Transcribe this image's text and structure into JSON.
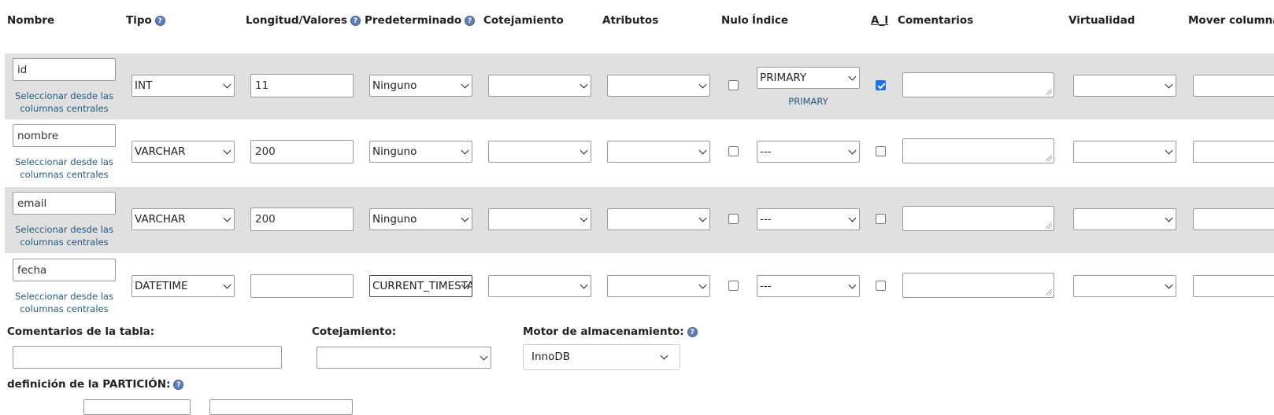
{
  "headers": {
    "nombre": "Nombre",
    "tipo": "Tipo",
    "longitud": "Longitud/Valores",
    "predeterminado": "Predeterminado",
    "cotejamiento": "Cotejamiento",
    "atributos": "Atributos",
    "nulo": "Nulo",
    "indice": "Índice",
    "ai": "A_I",
    "comentarios": "Comentarios",
    "virtualidad": "Virtualidad",
    "mover": "Mover columna"
  },
  "rows": [
    {
      "name": "id",
      "type": "INT",
      "length": "11",
      "default": "Ninguno",
      "collation": "",
      "attributes": "",
      "null": false,
      "index": "PRIMARY",
      "index_note": "PRIMARY",
      "ai": true,
      "comment": "",
      "virtuality": "",
      "move": ""
    },
    {
      "name": "nombre",
      "type": "VARCHAR",
      "length": "200",
      "default": "Ninguno",
      "collation": "",
      "attributes": "",
      "null": false,
      "index": "---",
      "index_note": "",
      "ai": false,
      "comment": "",
      "virtuality": "",
      "move": ""
    },
    {
      "name": "email",
      "type": "VARCHAR",
      "length": "200",
      "default": "Ninguno",
      "collation": "",
      "attributes": "",
      "null": false,
      "index": "---",
      "index_note": "",
      "ai": false,
      "comment": "",
      "virtuality": "",
      "move": ""
    },
    {
      "name": "fecha",
      "type": "DATETIME",
      "length": "",
      "default": "CURRENT_TIMESTAMP",
      "collation": "",
      "attributes": "",
      "null": false,
      "index": "---",
      "index_note": "",
      "ai": false,
      "comment": "",
      "virtuality": "",
      "move": ""
    }
  ],
  "central_link": "Seleccionar desde las columnas centrales",
  "table_options": {
    "comment_label": "Comentarios de la tabla:",
    "comment_value": "",
    "collation_label": "Cotejamiento:",
    "collation_value": "",
    "engine_label": "Motor de almacenamiento:",
    "engine_value": "InnoDB"
  },
  "partition_label": "definición de la PARTICIÓN:",
  "help_icon": "?"
}
